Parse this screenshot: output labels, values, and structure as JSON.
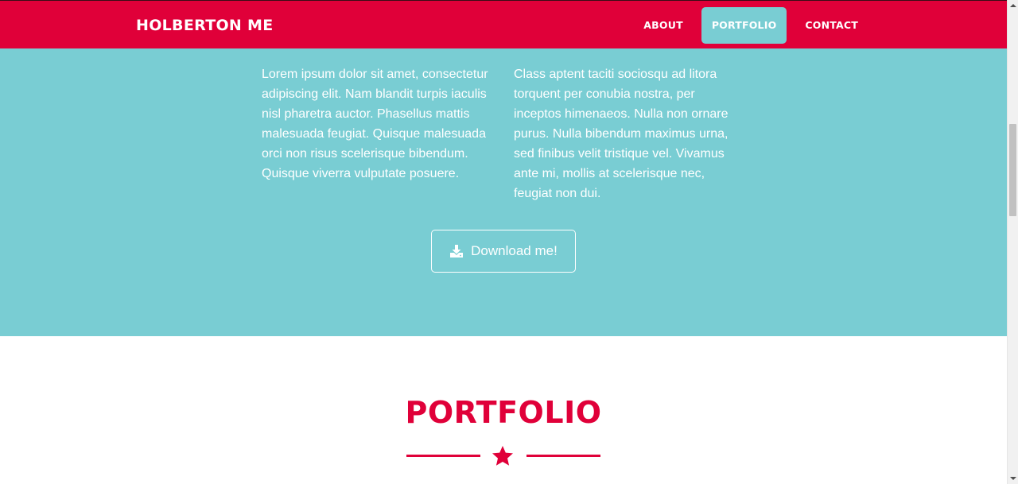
{
  "navbar": {
    "brand": "HOLBERTON ME",
    "links": [
      {
        "label": "ABOUT",
        "active": false
      },
      {
        "label": "PORTFOLIO",
        "active": true
      },
      {
        "label": "CONTACT",
        "active": false
      }
    ]
  },
  "about": {
    "left_text": "Lorem ipsum dolor sit amet, consectetur adipiscing elit. Nam blandit turpis iaculis nisl pharetra auctor. Phasellus mattis malesuada feugiat. Quisque malesuada orci non risus scelerisque bibendum. Quisque viverra vulputate posuere.",
    "right_text": "Class aptent taciti sociosqu ad litora torquent per conubia nostra, per inceptos himenaeos. Nulla non ornare purus. Nulla bibendum maximus urna, sed finibus velit tristique vel. Vivamus ante mi, mollis at scelerisque nec, feugiat non dui.",
    "download_label": "Download me!",
    "download_icon": "download-icon"
  },
  "portfolio": {
    "title": "PORTFOLIO",
    "divider_icon": "star-icon"
  },
  "colors": {
    "primary": "#e00039",
    "secondary": "#79cdd3",
    "text_light": "#ffffff"
  }
}
